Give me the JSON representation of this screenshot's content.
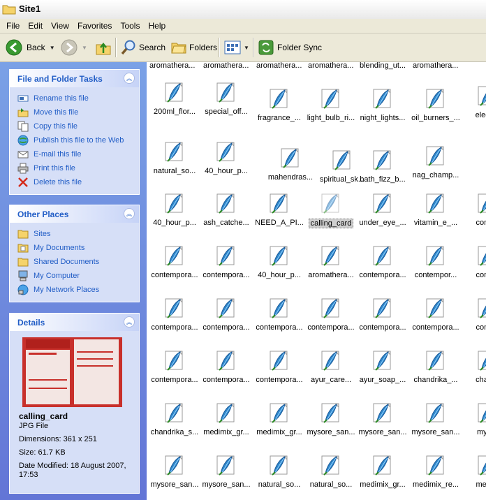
{
  "window": {
    "title": "Site1"
  },
  "menu": [
    "File",
    "Edit",
    "View",
    "Favorites",
    "Tools",
    "Help"
  ],
  "toolbar": {
    "back": "Back",
    "search": "Search",
    "folders": "Folders",
    "folder_sync": "Folder Sync"
  },
  "file_tasks": {
    "title": "File and Folder Tasks",
    "items": [
      "Rename this file",
      "Move this file",
      "Copy this file",
      "Publish this file to the Web",
      "E-mail this file",
      "Print this file",
      "Delete this file"
    ]
  },
  "other_places": {
    "title": "Other Places",
    "items": [
      "Sites",
      "My Documents",
      "Shared Documents",
      "My Computer",
      "My Network Places"
    ]
  },
  "details": {
    "title": "Details",
    "name": "calling_card",
    "type": "JPG File",
    "dimensions": "Dimensions: 361 x 251",
    "size": "Size: 61.7 KB",
    "modified_line1": "Date Modified: 18 August 2007,",
    "modified_line2": "17:53"
  },
  "files": {
    "top_row": [
      "aromathera...",
      "aromathera...",
      "aromathera...",
      "aromathera...",
      "blending_ut...",
      "aromathera..."
    ],
    "row1": [
      "200ml_flor...",
      "special_off...",
      "fragrance_...",
      "light_bulb_ri...",
      "night_lights...",
      "oil_burners_...",
      "electric"
    ],
    "row2": [
      "natural_so...",
      "40_hour_p...",
      "mahendras...",
      "spiritual_sk...",
      "bath_fizz_b...",
      "nag_champ..."
    ],
    "row3": [
      "40_hour_p...",
      "ash_catche...",
      "NEED_A_PI...",
      "calling_card",
      "under_eye_...",
      "vitamin_e_...",
      "conten"
    ],
    "row4": [
      "contempora...",
      "contempora...",
      "40_hour_p...",
      "aromathera...",
      "contempora...",
      "contempor...",
      "conten"
    ],
    "row5": [
      "contempora...",
      "contempora...",
      "contempora...",
      "contempora...",
      "contempora...",
      "contempora...",
      "conten"
    ],
    "row6": [
      "contempora...",
      "contempora...",
      "contempora...",
      "ayur_care...",
      "ayur_soap_...",
      "chandrika_...",
      "chandr"
    ],
    "row7": [
      "chandrika_s...",
      "medimix_gr...",
      "medimix_gr...",
      "mysore_san...",
      "mysore_san...",
      "mysore_san...",
      "mysor"
    ],
    "row8": [
      "mysore_san...",
      "mysore_san...",
      "natural_so...",
      "natural_so...",
      "medimix_gr...",
      "medimix_re...",
      "medim"
    ]
  }
}
